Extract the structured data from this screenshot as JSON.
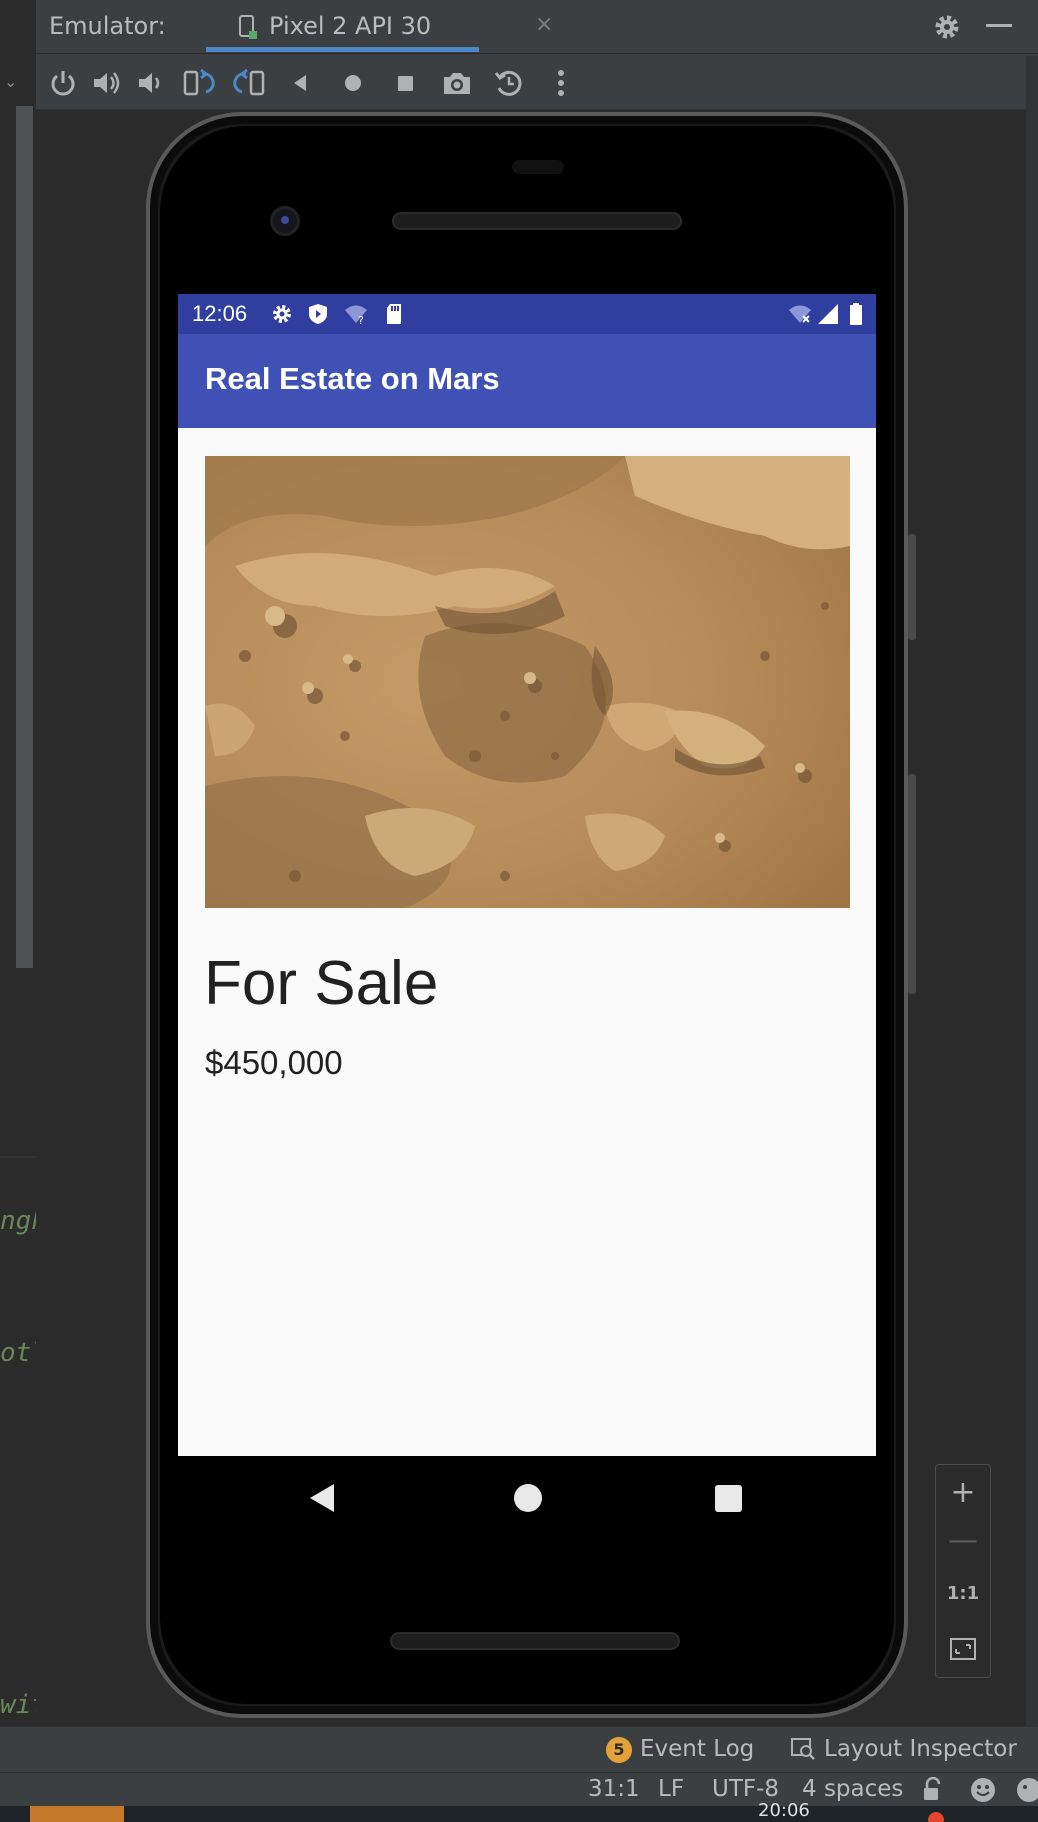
{
  "header": {
    "title": "Emulator:",
    "tab_label": "Pixel 2 API 30",
    "tab_close": "×"
  },
  "left_code": [
    "ngh",
    "otl",
    "wit"
  ],
  "toolbar": {
    "buttons": [
      "power-icon",
      "volume-up-icon",
      "volume-down-icon",
      "rotate-left-icon",
      "rotate-right-icon",
      "back-icon",
      "home-icon",
      "overview-icon",
      "camera-icon",
      "snapshot-icon",
      "more-icon"
    ]
  },
  "phone": {
    "status_time": "12:06",
    "app_title": "Real Estate on Mars",
    "headline": "For Sale",
    "price": "$450,000"
  },
  "zoom": {
    "zoom_in": "+",
    "zoom_out": "—",
    "actual_size": "1:1"
  },
  "bottom_panel": {
    "event_log_count": "5",
    "event_log": "Event Log",
    "layout_inspector": "Layout Inspector"
  },
  "status_bar": {
    "position": "31:1",
    "line_sep": "LF",
    "encoding": "UTF-8",
    "indent": "4 spaces"
  },
  "taskbar": {
    "clock_partial": "20:06"
  },
  "colors": {
    "ide_bg": "#3c3f41",
    "status_bar": "#303f9f",
    "app_bar": "#3f51b5",
    "accent_tab": "#4a88c7"
  }
}
